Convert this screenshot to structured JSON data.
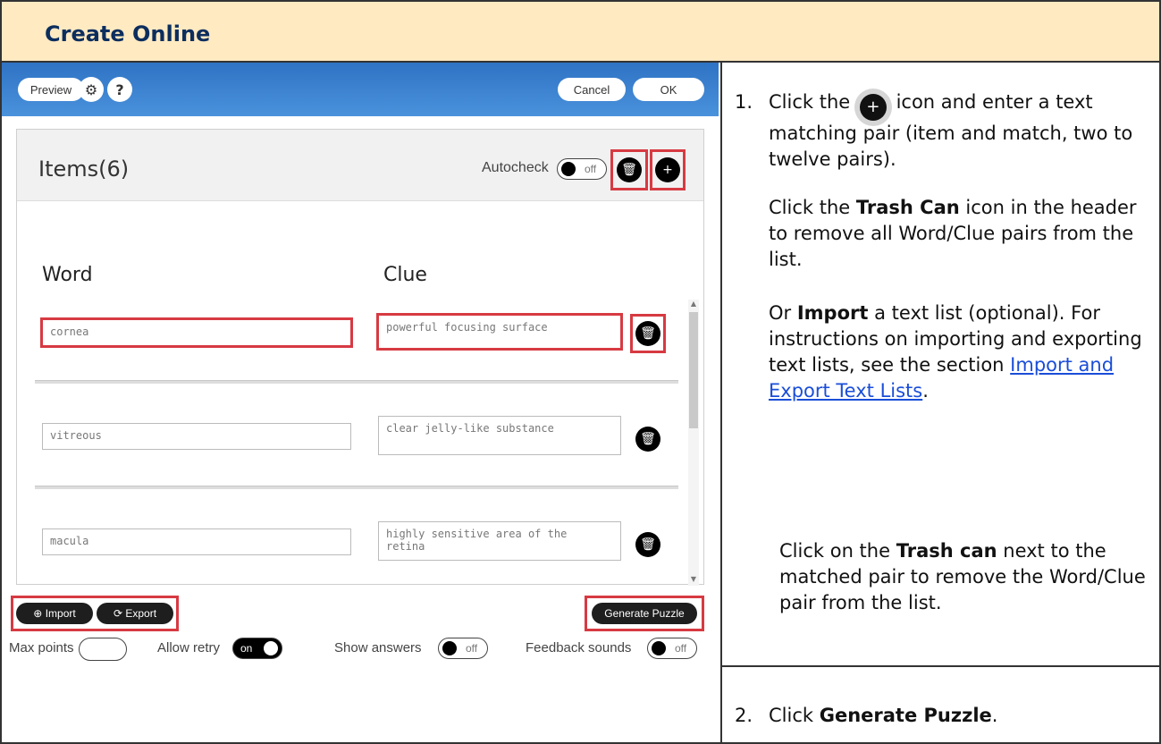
{
  "header": {
    "title": "Create Online"
  },
  "app": {
    "topbar": {
      "preview_label": "Preview",
      "settings_icon": "gear-icon",
      "help_label": "?",
      "cancel_label": "Cancel",
      "ok_label": "OK"
    },
    "panel": {
      "items_title": "Items(6)",
      "autocheck_label": "Autocheck",
      "autocheck_state": "off",
      "columns": {
        "word": "Word",
        "clue": "Clue"
      },
      "rows": [
        {
          "word": "cornea",
          "clue": "powerful focusing surface"
        },
        {
          "word": "vitreous",
          "clue": "clear jelly-like substance"
        },
        {
          "word": "macula",
          "clue": "highly sensitive area of the retina"
        }
      ]
    },
    "bottom": {
      "import_label": "Import",
      "export_label": "Export",
      "generate_label": "Generate Puzzle",
      "max_points_label": "Max points",
      "allow_retry_label": "Allow retry",
      "allow_retry_state": "on",
      "show_answers_label": "Show answers",
      "show_answers_state": "off",
      "feedback_sounds_label": "Feedback sounds",
      "feedback_sounds_state": "off"
    },
    "colors": {
      "topbar": "#3a80d0",
      "highlight": "#d73a42",
      "header_bg": "#ffeac2",
      "link": "#1a4ed8"
    }
  },
  "instructions": {
    "step1_num": "1.",
    "step1_a": "Click the",
    "step1_b": "icon and enter a text matching pair (item and match, two to twelve pairs).",
    "trash_a": "Click the",
    "trash_bold": "Trash Can",
    "trash_b": "icon in the header to remove all Word/Clue pairs from the list.",
    "import_a": "Or",
    "import_bold": "Import",
    "import_b": "a text list (optional).",
    "import_c": "For instructions on importing and exporting text lists, see the section",
    "import_link": "Import and Export Text Lists",
    "import_d": ".",
    "pair_a": "Click on the",
    "pair_bold": "Trash can",
    "pair_b": "next to the matched pair to remove the Word/Clue pair from the list.",
    "step2_num": "2.",
    "step2_a": "Click",
    "step2_bold": "Generate Puzzle",
    "step2_b": "."
  }
}
